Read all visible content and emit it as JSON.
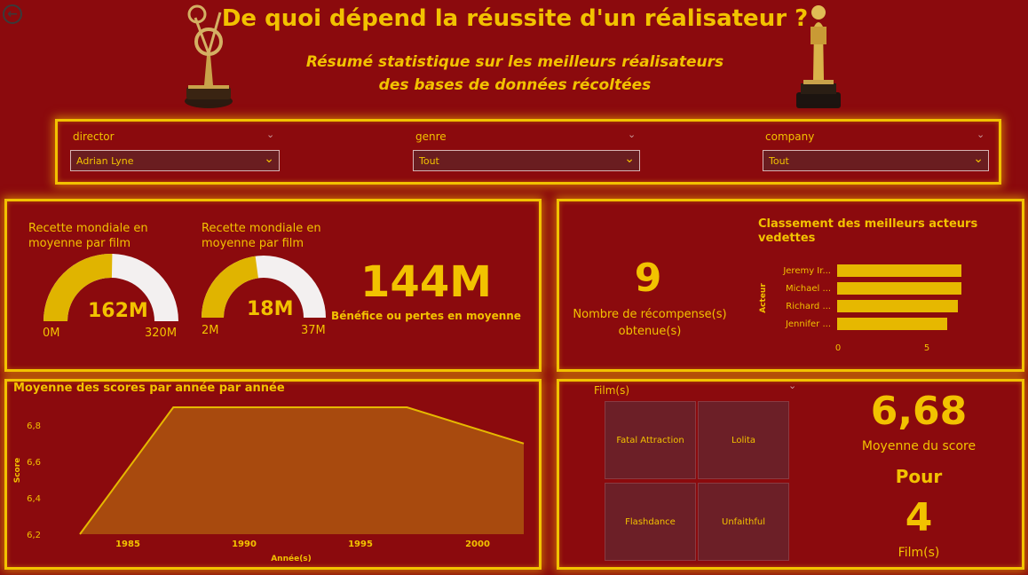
{
  "header": {
    "title": "De quoi dépend la réussite d'un réalisateur ?",
    "subtitle_line1": "Résumé statistique sur les meilleurs réalisateurs",
    "subtitle_line2": "des bases de données récoltées",
    "back_icon": "back-arrow-icon"
  },
  "filters": [
    {
      "label": "director",
      "value": "Adrian Lyne"
    },
    {
      "label": "genre",
      "value": "Tout"
    },
    {
      "label": "company",
      "value": "Tout"
    }
  ],
  "gauges": [
    {
      "label_line1": "Recette mondiale en",
      "label_line2": "moyenne par film",
      "value_text": "162M",
      "min_text": "0M",
      "max_text": "320M",
      "fill_fraction": 0.506
    },
    {
      "label_line1": "Recette mondiale en",
      "label_line2": "moyenne par film",
      "value_text": "18M",
      "min_text": "2M",
      "max_text": "37M",
      "fill_fraction": 0.457
    }
  ],
  "profit": {
    "value": "144M",
    "label": "Bénéfice ou pertes en moyenne"
  },
  "awards": {
    "value": "9",
    "label_line1": "Nombre de récompense(s)",
    "label_line2": "obtenue(s)"
  },
  "actors_chart": {
    "title_line1": "Classement des meilleurs acteurs",
    "title_line2": "vedettes",
    "y_axis_label": "Acteur",
    "x_ticks": [
      "0",
      "5"
    ]
  },
  "scores_chart": {
    "title": "Moyenne des scores par année par année",
    "y_label": "Score",
    "x_label": "Année(s)",
    "y_ticks": [
      "6,8",
      "6,6",
      "6,4",
      "6,2"
    ],
    "x_ticks": [
      "1985",
      "1990",
      "1995",
      "2000"
    ]
  },
  "films": {
    "label": "Film(s)",
    "tiles": [
      "Fatal Attraction",
      "Lolita",
      "Flashdance",
      "Unfaithful"
    ]
  },
  "score_summary": {
    "value": "6,68",
    "label": "Moyenne du score",
    "pour": "Pour",
    "count": "4",
    "count_label": "Film(s)"
  },
  "chart_data": [
    {
      "type": "bar",
      "orientation": "horizontal",
      "title": "Classement des meilleurs acteurs vedettes",
      "ylabel": "Acteur",
      "categories": [
        "Jeremy Ir...",
        "Michael ...",
        "Richard ...",
        "Jennifer ..."
      ],
      "values": [
        7,
        7,
        6.8,
        6.2
      ],
      "xlim": [
        0,
        7.5
      ],
      "color": "#e6b800"
    },
    {
      "type": "area",
      "title": "Moyenne des scores par année par année",
      "xlabel": "Année(s)",
      "ylabel": "Score",
      "x": [
        1983,
        1987,
        1997,
        2002
      ],
      "y": [
        6.2,
        6.9,
        6.9,
        6.7
      ],
      "xlim": [
        1983,
        2002
      ],
      "ylim": [
        6.2,
        6.9
      ],
      "fill": "#a84a0e",
      "stroke": "#e6b800"
    }
  ]
}
